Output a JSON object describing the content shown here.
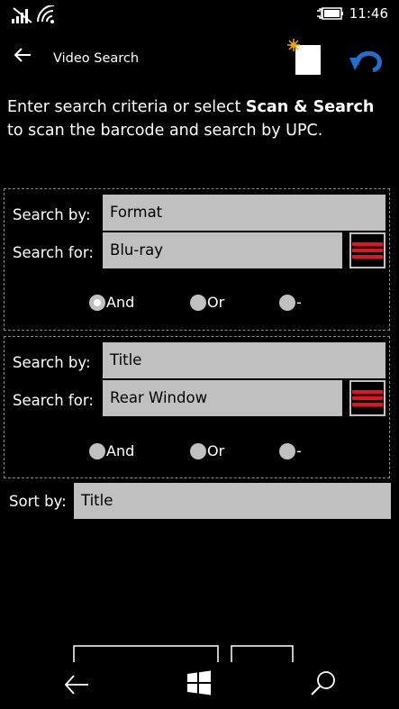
{
  "status": {
    "time": "11:46"
  },
  "header": {
    "title": "Video Search"
  },
  "instructions": {
    "prefix": "Enter search criteria or select ",
    "bold": "Scan & Search",
    "suffix": " to scan the barcode and search by UPC."
  },
  "criteria": [
    {
      "search_by_label": "Search by:",
      "search_by_value": "Format",
      "search_for_label": "Search for:",
      "search_for_value": "Blu-ray",
      "options": [
        "And",
        "Or",
        "-"
      ],
      "selected": "And"
    },
    {
      "search_by_label": "Search by:",
      "search_by_value": "Title",
      "search_for_label": "Search for:",
      "search_for_value": "Rear Window",
      "options": [
        "And",
        "Or",
        "-"
      ],
      "selected": ""
    }
  ],
  "sort": {
    "label": "Sort by:",
    "value": "Title"
  },
  "colors": {
    "accent": "#1f6fd1",
    "delete": "#e81123",
    "field": "#c0c0c0"
  }
}
